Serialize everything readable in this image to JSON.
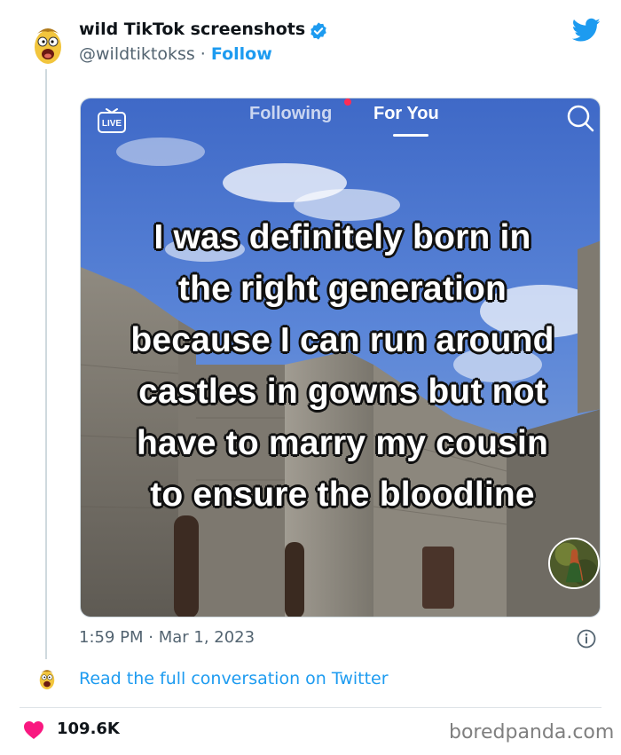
{
  "tweet": {
    "display_name": "wild TikTok screenshots",
    "handle": "@wildtiktokss",
    "separator": " · ",
    "follow_label": "Follow",
    "timestamp": "1:59 PM · Mar 1, 2023",
    "read_link": "Read the full conversation on Twitter",
    "like_count": "109.6K",
    "verified": true
  },
  "tiktok": {
    "live_label": "LIVE",
    "tab_following": "Following",
    "tab_for_you": "For You",
    "active_tab": "For You",
    "caption_lines": [
      "I was definitely born in",
      "the right generation",
      "because I can run around",
      "castles in gowns but not",
      "have to marry my cousin",
      "to ensure the bloodline"
    ]
  },
  "watermark": "boredpanda.com",
  "colors": {
    "twitter_blue": "#1d9bf0",
    "heart": "#f91880",
    "muted_text": "#536471",
    "tiktok_red": "#fe2c55"
  },
  "icons": {
    "verified": "verified-badge-icon",
    "twitter": "twitter-bird-icon",
    "live": "live-tv-icon",
    "search": "search-icon",
    "info": "info-icon",
    "heart": "heart-icon"
  }
}
